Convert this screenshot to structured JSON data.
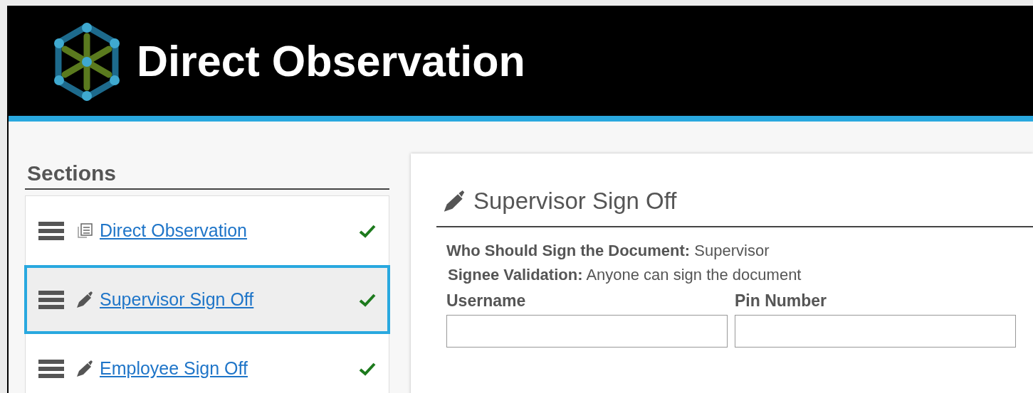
{
  "header": {
    "title": "Direct Observation"
  },
  "sidebar": {
    "title": "Sections",
    "items": [
      {
        "label": "Direct Observation",
        "kind": "document",
        "selected": false,
        "complete": true
      },
      {
        "label": "Supervisor Sign Off",
        "kind": "signature",
        "selected": true,
        "complete": true
      },
      {
        "label": "Employee Sign Off",
        "kind": "signature",
        "selected": false,
        "complete": true
      }
    ]
  },
  "panel": {
    "title": "Supervisor Sign Off",
    "info": [
      {
        "label": "Who Should Sign the Document:",
        "value": "Supervisor"
      },
      {
        "label": "Signee Validation:",
        "value": "Anyone can sign the document"
      }
    ],
    "fields": [
      {
        "label": "Username"
      },
      {
        "label": "Pin Number"
      }
    ]
  }
}
